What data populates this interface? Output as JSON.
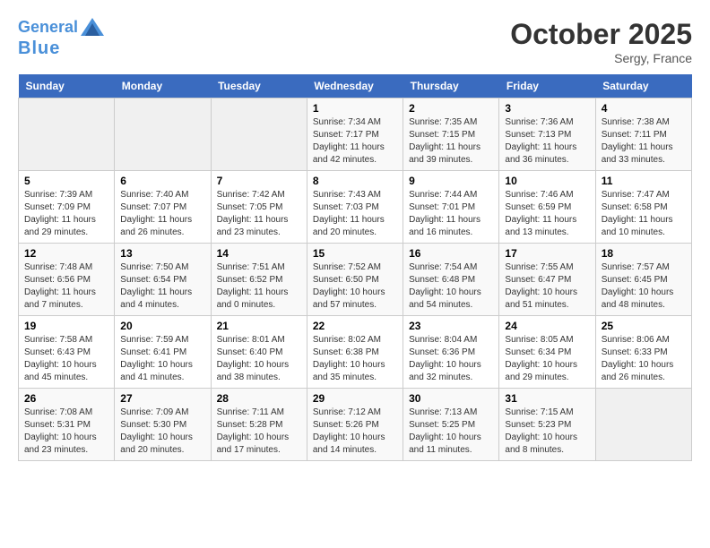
{
  "header": {
    "logo_line1": "General",
    "logo_line2": "Blue",
    "month": "October 2025",
    "location": "Sergy, France"
  },
  "weekdays": [
    "Sunday",
    "Monday",
    "Tuesday",
    "Wednesday",
    "Thursday",
    "Friday",
    "Saturday"
  ],
  "weeks": [
    [
      {
        "day": "",
        "empty": true
      },
      {
        "day": "",
        "empty": true
      },
      {
        "day": "",
        "empty": true
      },
      {
        "day": "1",
        "sunrise": "7:34 AM",
        "sunset": "7:17 PM",
        "daylight": "11 hours and 42 minutes."
      },
      {
        "day": "2",
        "sunrise": "7:35 AM",
        "sunset": "7:15 PM",
        "daylight": "11 hours and 39 minutes."
      },
      {
        "day": "3",
        "sunrise": "7:36 AM",
        "sunset": "7:13 PM",
        "daylight": "11 hours and 36 minutes."
      },
      {
        "day": "4",
        "sunrise": "7:38 AM",
        "sunset": "7:11 PM",
        "daylight": "11 hours and 33 minutes."
      }
    ],
    [
      {
        "day": "5",
        "sunrise": "7:39 AM",
        "sunset": "7:09 PM",
        "daylight": "11 hours and 29 minutes."
      },
      {
        "day": "6",
        "sunrise": "7:40 AM",
        "sunset": "7:07 PM",
        "daylight": "11 hours and 26 minutes."
      },
      {
        "day": "7",
        "sunrise": "7:42 AM",
        "sunset": "7:05 PM",
        "daylight": "11 hours and 23 minutes."
      },
      {
        "day": "8",
        "sunrise": "7:43 AM",
        "sunset": "7:03 PM",
        "daylight": "11 hours and 20 minutes."
      },
      {
        "day": "9",
        "sunrise": "7:44 AM",
        "sunset": "7:01 PM",
        "daylight": "11 hours and 16 minutes."
      },
      {
        "day": "10",
        "sunrise": "7:46 AM",
        "sunset": "6:59 PM",
        "daylight": "11 hours and 13 minutes."
      },
      {
        "day": "11",
        "sunrise": "7:47 AM",
        "sunset": "6:58 PM",
        "daylight": "11 hours and 10 minutes."
      }
    ],
    [
      {
        "day": "12",
        "sunrise": "7:48 AM",
        "sunset": "6:56 PM",
        "daylight": "11 hours and 7 minutes."
      },
      {
        "day": "13",
        "sunrise": "7:50 AM",
        "sunset": "6:54 PM",
        "daylight": "11 hours and 4 minutes."
      },
      {
        "day": "14",
        "sunrise": "7:51 AM",
        "sunset": "6:52 PM",
        "daylight": "11 hours and 0 minutes."
      },
      {
        "day": "15",
        "sunrise": "7:52 AM",
        "sunset": "6:50 PM",
        "daylight": "10 hours and 57 minutes."
      },
      {
        "day": "16",
        "sunrise": "7:54 AM",
        "sunset": "6:48 PM",
        "daylight": "10 hours and 54 minutes."
      },
      {
        "day": "17",
        "sunrise": "7:55 AM",
        "sunset": "6:47 PM",
        "daylight": "10 hours and 51 minutes."
      },
      {
        "day": "18",
        "sunrise": "7:57 AM",
        "sunset": "6:45 PM",
        "daylight": "10 hours and 48 minutes."
      }
    ],
    [
      {
        "day": "19",
        "sunrise": "7:58 AM",
        "sunset": "6:43 PM",
        "daylight": "10 hours and 45 minutes."
      },
      {
        "day": "20",
        "sunrise": "7:59 AM",
        "sunset": "6:41 PM",
        "daylight": "10 hours and 41 minutes."
      },
      {
        "day": "21",
        "sunrise": "8:01 AM",
        "sunset": "6:40 PM",
        "daylight": "10 hours and 38 minutes."
      },
      {
        "day": "22",
        "sunrise": "8:02 AM",
        "sunset": "6:38 PM",
        "daylight": "10 hours and 35 minutes."
      },
      {
        "day": "23",
        "sunrise": "8:04 AM",
        "sunset": "6:36 PM",
        "daylight": "10 hours and 32 minutes."
      },
      {
        "day": "24",
        "sunrise": "8:05 AM",
        "sunset": "6:34 PM",
        "daylight": "10 hours and 29 minutes."
      },
      {
        "day": "25",
        "sunrise": "8:06 AM",
        "sunset": "6:33 PM",
        "daylight": "10 hours and 26 minutes."
      }
    ],
    [
      {
        "day": "26",
        "sunrise": "7:08 AM",
        "sunset": "5:31 PM",
        "daylight": "10 hours and 23 minutes."
      },
      {
        "day": "27",
        "sunrise": "7:09 AM",
        "sunset": "5:30 PM",
        "daylight": "10 hours and 20 minutes."
      },
      {
        "day": "28",
        "sunrise": "7:11 AM",
        "sunset": "5:28 PM",
        "daylight": "10 hours and 17 minutes."
      },
      {
        "day": "29",
        "sunrise": "7:12 AM",
        "sunset": "5:26 PM",
        "daylight": "10 hours and 14 minutes."
      },
      {
        "day": "30",
        "sunrise": "7:13 AM",
        "sunset": "5:25 PM",
        "daylight": "10 hours and 11 minutes."
      },
      {
        "day": "31",
        "sunrise": "7:15 AM",
        "sunset": "5:23 PM",
        "daylight": "10 hours and 8 minutes."
      },
      {
        "day": "",
        "empty": true
      }
    ]
  ]
}
